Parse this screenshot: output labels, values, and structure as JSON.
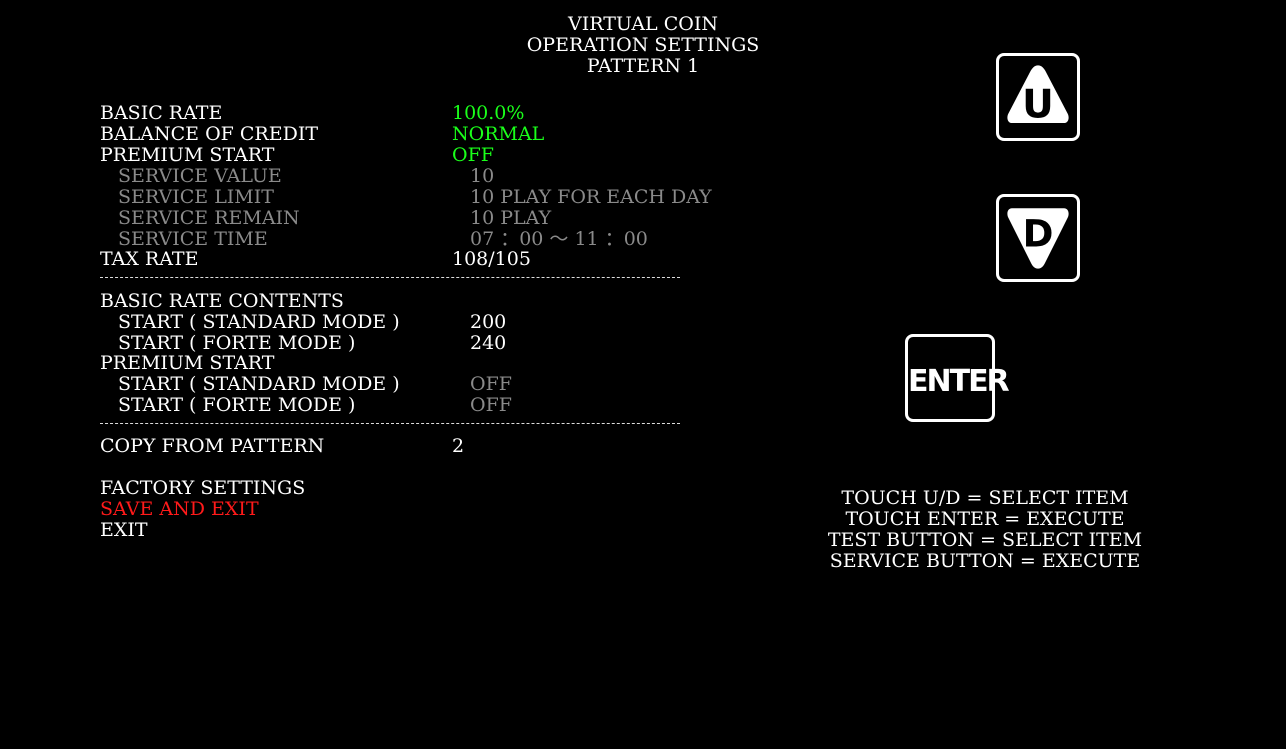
{
  "header": {
    "line1": "VIRTUAL COIN",
    "line2": "OPERATION SETTINGS",
    "line3": "PATTERN 1"
  },
  "settings": {
    "basic_rate": {
      "label": "BASIC RATE",
      "value": "100.0%"
    },
    "balance_of_credit": {
      "label": "BALANCE OF CREDIT",
      "value": "NORMAL"
    },
    "premium_start": {
      "label": "PREMIUM START",
      "value": "OFF"
    },
    "service_value": {
      "label": "SERVICE VALUE",
      "value": "10"
    },
    "service_limit": {
      "label": "SERVICE LIMIT",
      "value": "10 PLAY FOR EACH DAY"
    },
    "service_remain": {
      "label": "SERVICE REMAIN",
      "value": "10 PLAY"
    },
    "service_time": {
      "label": "SERVICE TIME",
      "value": "07 ：00 ～ 11 ：00"
    },
    "tax_rate": {
      "label": "TAX RATE",
      "value": "108/105"
    }
  },
  "contents": {
    "basic_rate_contents_label": "BASIC RATE CONTENTS",
    "basic_standard": {
      "label": "START ( STANDARD MODE )",
      "value": "200"
    },
    "basic_forte": {
      "label": "START ( FORTE MODE )",
      "value": "240"
    },
    "premium_start_label": "PREMIUM START",
    "premium_standard": {
      "label": "START ( STANDARD MODE )",
      "value": "OFF"
    },
    "premium_forte": {
      "label": "START ( FORTE MODE )",
      "value": "OFF"
    }
  },
  "copy_from_pattern": {
    "label": "COPY FROM PATTERN",
    "value": "2"
  },
  "menu": {
    "factory_settings": "FACTORY SETTINGS",
    "save_and_exit": "SAVE AND EXIT",
    "exit": "EXIT"
  },
  "buttons": {
    "up": "U",
    "down": "D",
    "enter": "ENTER"
  },
  "help": {
    "line1": "TOUCH U/D = SELECT ITEM",
    "line2": "TOUCH ENTER = EXECUTE",
    "line3": "TEST BUTTON = SELECT ITEM",
    "line4": "SERVICE BUTTON = EXECUTE"
  },
  "colors": {
    "value_active": "#1aff1a",
    "disabled": "#8a8a8a",
    "selected": "#ff1a1a",
    "text": "#ffffff",
    "background": "#000000"
  }
}
